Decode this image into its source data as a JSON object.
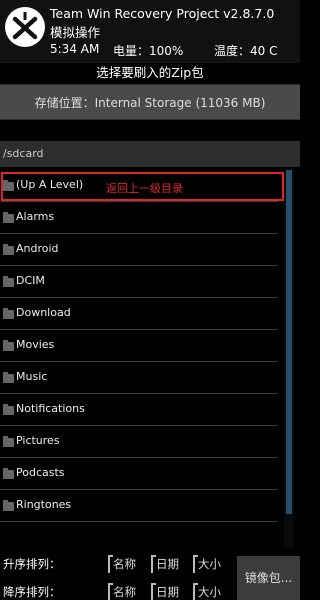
{
  "header": {
    "title": "Team Win Recovery Project  v2.8.7.0",
    "subtitle": "模拟操作",
    "time": "5:34 AM",
    "battery": "电量：100%",
    "temperature": "温度：40 C"
  },
  "instruction": "选择要刷入的Zip包",
  "storage_button": "存储位置：Internal Storage (11036 MB)",
  "path": "/sdcard",
  "annotation": "返回上一级目录",
  "files": [
    {
      "label": "(Up A Level)"
    },
    {
      "label": "Alarms"
    },
    {
      "label": "Android"
    },
    {
      "label": "DCIM"
    },
    {
      "label": "Download"
    },
    {
      "label": "Movies"
    },
    {
      "label": "Music"
    },
    {
      "label": "Notifications"
    },
    {
      "label": "Pictures"
    },
    {
      "label": "Podcasts"
    },
    {
      "label": "Ringtones"
    }
  ],
  "sort": {
    "asc_label": "升序排列：",
    "desc_label": "降序排列：",
    "by_name": "名称",
    "by_date": "日期",
    "by_size": "大小"
  },
  "mirror_button": "镜像包..."
}
